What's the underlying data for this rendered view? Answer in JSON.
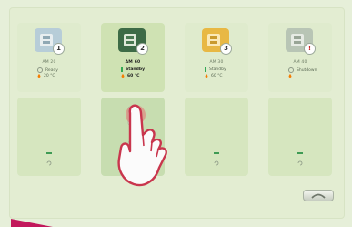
{
  "screen_title": "",
  "devices": [
    {
      "slot": "1",
      "name": "AM 20",
      "status": "Ready",
      "temp": "20 °C",
      "badge": "1",
      "icon_color": "#b7cdd8",
      "highlighted": false
    },
    {
      "slot": "2",
      "name": "AM 60",
      "status": "Standby",
      "temp": "60 °C",
      "badge": "2",
      "icon_color": "#3d6b46",
      "highlighted": true
    },
    {
      "slot": "3",
      "name": "AM 30",
      "status": "Standby",
      "temp": "60 °C",
      "badge": "3",
      "icon_color": "#e8b844",
      "highlighted": false
    },
    {
      "slot": "4",
      "name": "AM 40",
      "status": "Shutdown",
      "temp": "",
      "badge": "!",
      "icon_color": "#b8c5b5",
      "highlighted": false
    }
  ],
  "lower_slots": [
    {
      "state": "empty"
    },
    {
      "state": "selected"
    },
    {
      "state": "empty"
    },
    {
      "state": "empty"
    }
  ],
  "colors": {
    "accent_magenta": "#c2185b",
    "status_green": "#34a853",
    "temp_orange": "#f57c00"
  },
  "icons": {
    "back": "back-arrow-icon",
    "touch": "pointing-hand-icon"
  }
}
